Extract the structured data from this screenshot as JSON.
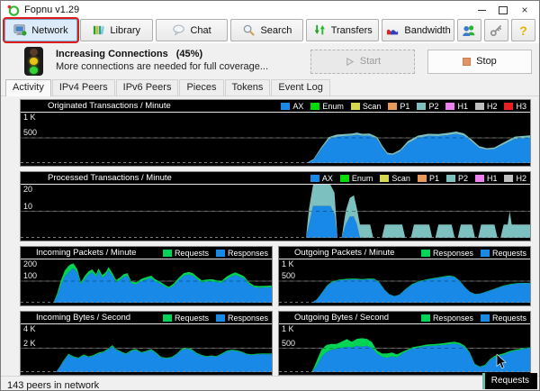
{
  "window": {
    "title": "Fopnu v1.29"
  },
  "toolbar": {
    "buttons": [
      {
        "label": "Network",
        "selected": true
      },
      {
        "label": "Library"
      },
      {
        "label": "Chat"
      },
      {
        "label": "Search"
      },
      {
        "label": "Transfers"
      },
      {
        "label": "Bandwidth"
      }
    ],
    "help_glyph": "?"
  },
  "status_panel": {
    "title": "Increasing Connections",
    "percent": "(45%)",
    "subtitle": "More connections are needed for full coverage...",
    "start_label": "Start",
    "stop_label": "Stop"
  },
  "tabs": {
    "active": "Activity",
    "items": [
      "Activity",
      "IPv4 Peers",
      "IPv6 Peers",
      "Pieces",
      "Tokens",
      "Event Log"
    ]
  },
  "statusbar": {
    "text": "143 peers in network"
  },
  "tooltip": {
    "label": "Requests"
  },
  "chart_data": [
    {
      "type": "area",
      "layout": "full",
      "title": "Originated Transactions / Minute",
      "ylim": [
        0,
        1000
      ],
      "yticks": {
        "top": "1 K",
        "mid": "500"
      },
      "grid": "mid-line plus dashed baseline",
      "legend_position": "top-right",
      "legend": [
        {
          "name": "AX",
          "color": "#1989e8"
        },
        {
          "name": "Enum",
          "color": "#00dd00"
        },
        {
          "name": "Scan",
          "color": "#d8d850"
        },
        {
          "name": "P1",
          "color": "#e89858"
        },
        {
          "name": "P2",
          "color": "#7cc0c0"
        },
        {
          "name": "H1",
          "color": "#f080f0"
        },
        {
          "name": "H2",
          "color": "#c0c0c0"
        },
        {
          "name": "H3",
          "color": "#e82020"
        }
      ],
      "x": [
        0,
        56,
        57.5,
        59,
        60.5,
        62,
        63.5,
        65,
        66,
        67,
        68.5,
        70,
        71,
        72,
        73,
        74.5,
        76,
        78,
        80,
        82,
        84,
        85.5,
        87,
        88.5,
        90,
        91.5,
        93,
        95,
        97,
        100
      ],
      "series": [
        {
          "name": "AX",
          "color": "#1989e8",
          "values": [
            0,
            0,
            60,
            280,
            470,
            520,
            535,
            545,
            560,
            540,
            545,
            470,
            300,
            175,
            160,
            230,
            390,
            500,
            540,
            535,
            555,
            580,
            545,
            430,
            300,
            265,
            280,
            380,
            480,
            505
          ]
        },
        {
          "name": "P2",
          "color": "#7cc0c0",
          "values": [
            0,
            0,
            20,
            35,
            45,
            45,
            40,
            40,
            45,
            40,
            40,
            45,
            40,
            30,
            30,
            35,
            45,
            45,
            40,
            40,
            45,
            45,
            45,
            40,
            35,
            30,
            30,
            40,
            45,
            45
          ]
        }
      ]
    },
    {
      "type": "area",
      "layout": "full",
      "title": "Processed Transactions / Minute",
      "ylim": [
        0,
        20
      ],
      "yticks": {
        "top": "20",
        "mid": "10"
      },
      "grid": "mid-line plus dashed baseline",
      "legend_position": "top-right",
      "legend": [
        {
          "name": "AX",
          "color": "#1989e8"
        },
        {
          "name": "Enum",
          "color": "#00dd00"
        },
        {
          "name": "Scan",
          "color": "#d8d850"
        },
        {
          "name": "P1",
          "color": "#e89858"
        },
        {
          "name": "P2",
          "color": "#7cc0c0"
        },
        {
          "name": "H1",
          "color": "#f080f0"
        },
        {
          "name": "H2",
          "color": "#c0c0c0"
        }
      ],
      "x": [
        0,
        56,
        56.6,
        57.4,
        60.8,
        61.6,
        62.2,
        63,
        63.8,
        64.6,
        65.4,
        66,
        66.6,
        68.6,
        69.2,
        70.9,
        71.5,
        74.9,
        75.5,
        76.6,
        77.2,
        80.2,
        80.8,
        81.4,
        82,
        84.6,
        85.2,
        85.8,
        86.4,
        88.6,
        89.2,
        89.8,
        90.4,
        93,
        93.6,
        94.2,
        94.8,
        95.6,
        96,
        96.4,
        97,
        100
      ],
      "series": [
        {
          "name": "AX",
          "color": "#1989e8",
          "values": [
            0,
            0,
            5,
            12,
            12,
            9,
            0,
            0,
            5,
            8,
            8,
            5,
            0,
            0,
            0,
            0,
            0,
            0,
            0,
            0,
            0,
            0,
            0,
            0,
            0,
            0,
            0,
            0,
            0,
            0,
            0,
            0,
            0,
            0,
            0,
            0,
            0,
            0,
            0,
            0,
            0,
            0
          ]
        },
        {
          "name": "P2",
          "color": "#7cc0c0",
          "values": [
            0,
            0,
            6,
            9,
            9,
            8,
            0,
            0,
            5,
            7,
            8,
            6,
            5,
            5,
            0,
            0,
            5,
            5,
            0,
            0,
            5,
            5,
            0,
            0,
            5,
            5,
            0,
            0,
            5,
            5,
            0,
            0,
            5,
            5,
            0,
            0,
            5,
            5,
            10,
            5,
            5,
            5
          ]
        }
      ]
    },
    {
      "type": "area",
      "layout": "half",
      "title": "Incoming Packets / Minute",
      "ylim": [
        0,
        200
      ],
      "yticks": {
        "top": "200",
        "mid": "100"
      },
      "grid": "mid-line plus dashed baseline",
      "legend_position": "top-right",
      "legend": [
        {
          "name": "Requests",
          "color": "#00d455"
        },
        {
          "name": "Responses",
          "color": "#1989e8"
        }
      ],
      "x": [
        0,
        13,
        14.5,
        16,
        17.5,
        19,
        20,
        21,
        22.5,
        24,
        25.5,
        27,
        28.5,
        30,
        31,
        32.5,
        34,
        35,
        36.5,
        38,
        39.5,
        41,
        42.5,
        44,
        46,
        48,
        50,
        52,
        53.5,
        55,
        57,
        59,
        61,
        63,
        65,
        67,
        68.5,
        70,
        72,
        74,
        76,
        78,
        80,
        82,
        84,
        85.5,
        87,
        89,
        91,
        93,
        95,
        100
      ],
      "series": [
        {
          "name": "Responses",
          "color": "#1989e8",
          "values": [
            0,
            0,
            30,
            80,
            120,
            140,
            150,
            160,
            140,
            85,
            110,
            130,
            140,
            120,
            145,
            115,
            130,
            150,
            125,
            95,
            105,
            120,
            125,
            90,
            85,
            100,
            108,
            115,
            100,
            92,
            78,
            66,
            80,
            105,
            125,
            130,
            125,
            112,
            95,
            98,
            100,
            95,
            92,
            110,
            122,
            128,
            122,
            112,
            85,
            72,
            70,
            72
          ]
        },
        {
          "name": "Requests",
          "color": "#00d455",
          "values": [
            0,
            0,
            12,
            22,
            28,
            30,
            28,
            22,
            16,
            10,
            14,
            15,
            14,
            12,
            14,
            12,
            13,
            15,
            12,
            10,
            11,
            12,
            12,
            9,
            9,
            10,
            10,
            10,
            9,
            9,
            8,
            7,
            9,
            11,
            12,
            12,
            12,
            10,
            9,
            9,
            9,
            9,
            9,
            11,
            12,
            12,
            11,
            10,
            8,
            7,
            7,
            7
          ]
        }
      ]
    },
    {
      "type": "area",
      "layout": "half",
      "title": "Outgoing Packets / Minute",
      "ylim": [
        0,
        1000
      ],
      "yticks": {
        "top": "1 K",
        "mid": "500"
      },
      "grid": "mid-line plus dashed baseline",
      "legend_position": "top-right",
      "legend": [
        {
          "name": "Responses",
          "color": "#00d455"
        },
        {
          "name": "Requests",
          "color": "#1989e8"
        }
      ],
      "x": [
        0,
        13,
        15,
        17,
        19,
        21,
        24,
        27,
        30,
        33,
        36,
        38,
        40,
        42,
        44,
        46,
        48,
        50,
        53,
        56,
        59,
        62,
        64,
        66,
        68,
        70,
        72,
        74,
        76,
        78,
        80,
        83,
        86,
        89,
        92,
        95,
        100
      ],
      "series": [
        {
          "name": "Requests",
          "color": "#1989e8",
          "values": [
            0,
            0,
            70,
            220,
            380,
            470,
            520,
            535,
            545,
            530,
            545,
            540,
            460,
            300,
            190,
            150,
            185,
            290,
            420,
            490,
            530,
            560,
            580,
            600,
            615,
            590,
            500,
            360,
            250,
            200,
            205,
            260,
            320,
            380,
            420,
            445,
            450
          ]
        },
        {
          "name": "Responses",
          "color": "#00d455",
          "values": [
            0,
            0,
            5,
            10,
            14,
            16,
            16,
            16,
            16,
            16,
            16,
            14,
            12,
            8,
            5,
            5,
            6,
            9,
            12,
            13,
            14,
            15,
            15,
            15,
            15,
            13,
            11,
            8,
            6,
            5,
            5,
            7,
            9,
            10,
            11,
            11,
            11
          ]
        }
      ]
    },
    {
      "type": "area",
      "layout": "half",
      "title": "Incoming Bytes / Second",
      "ylim": [
        0,
        4000
      ],
      "yticks": {
        "top": "4 K",
        "mid": "2 K"
      },
      "grid": "mid-line plus dashed baseline",
      "legend_position": "top-right",
      "legend": [
        {
          "name": "Requests",
          "color": "#00d455"
        },
        {
          "name": "Responses",
          "color": "#1989e8"
        }
      ],
      "x": [
        0,
        14,
        15.5,
        17,
        19,
        21,
        23,
        25,
        27,
        29,
        31,
        33,
        35,
        36.5,
        38,
        40,
        42,
        44,
        46,
        48,
        50,
        52,
        54,
        56,
        58,
        60,
        62,
        64,
        66,
        68,
        70,
        72,
        74,
        76,
        78,
        80,
        82,
        84,
        86,
        88,
        90,
        92,
        94,
        96,
        100
      ],
      "series": [
        {
          "name": "Responses",
          "color": "#1989e8",
          "values": [
            0,
            0,
            400,
            900,
            1450,
            1250,
            1150,
            1400,
            1250,
            1350,
            1550,
            1650,
            1900,
            2150,
            1850,
            1650,
            1500,
            1750,
            1850,
            1600,
            1700,
            1850,
            1550,
            1200,
            1150,
            1200,
            1450,
            1850,
            1950,
            1850,
            1550,
            1380,
            1280,
            1330,
            1280,
            1480,
            1700,
            1800,
            1750,
            1650,
            1480,
            1430,
            1480,
            1500,
            1500
          ]
        },
        {
          "name": "Requests",
          "color": "#00d455",
          "values": [
            0,
            0,
            30,
            60,
            80,
            70,
            60,
            70,
            60,
            70,
            80,
            80,
            90,
            100,
            80,
            70,
            70,
            80,
            80,
            70,
            70,
            80,
            70,
            60,
            60,
            60,
            70,
            80,
            90,
            80,
            70,
            60,
            60,
            60,
            60,
            70,
            80,
            80,
            80,
            70,
            60,
            60,
            60,
            60,
            60
          ]
        }
      ]
    },
    {
      "type": "area",
      "layout": "half",
      "title": "Outgoing Bytes / Second",
      "ylim": [
        0,
        1000
      ],
      "yticks": {
        "top": "1 K",
        "mid": "500"
      },
      "grid": "mid-line plus dashed baseline",
      "legend_position": "top-right",
      "legend": [
        {
          "name": "Responses",
          "color": "#00d455"
        },
        {
          "name": "Requests",
          "color": "#1989e8"
        }
      ],
      "x": [
        0,
        13,
        14,
        15.5,
        17,
        19,
        21,
        23,
        25,
        27,
        29,
        31,
        33,
        35,
        37,
        39,
        41,
        43,
        45,
        47,
        49,
        51,
        53,
        56,
        59,
        62,
        65,
        68,
        70,
        72,
        74,
        76,
        78,
        80,
        82,
        84,
        86,
        88,
        90,
        92,
        94,
        96,
        98,
        100
      ],
      "series": [
        {
          "name": "Requests",
          "color": "#1989e8",
          "values": [
            0,
            0,
            60,
            180,
            320,
            420,
            470,
            490,
            510,
            530,
            515,
            550,
            530,
            550,
            510,
            390,
            320,
            300,
            330,
            310,
            380,
            440,
            490,
            520,
            545,
            555,
            565,
            585,
            595,
            575,
            520,
            390,
            160,
            105,
            135,
            250,
            315,
            345,
            375,
            415,
            445,
            465,
            495,
            505
          ]
        },
        {
          "name": "Responses",
          "color": "#00d455",
          "values": [
            0,
            0,
            50,
            120,
            160,
            150,
            120,
            100,
            130,
            160,
            120,
            145,
            180,
            145,
            120,
            60,
            70,
            90,
            80,
            60,
            40,
            30,
            28,
            28,
            32,
            32,
            36,
            40,
            40,
            36,
            30,
            20,
            12,
            12,
            16,
            22,
            26,
            26,
            26,
            26,
            24,
            20,
            16,
            12
          ]
        }
      ]
    }
  ]
}
